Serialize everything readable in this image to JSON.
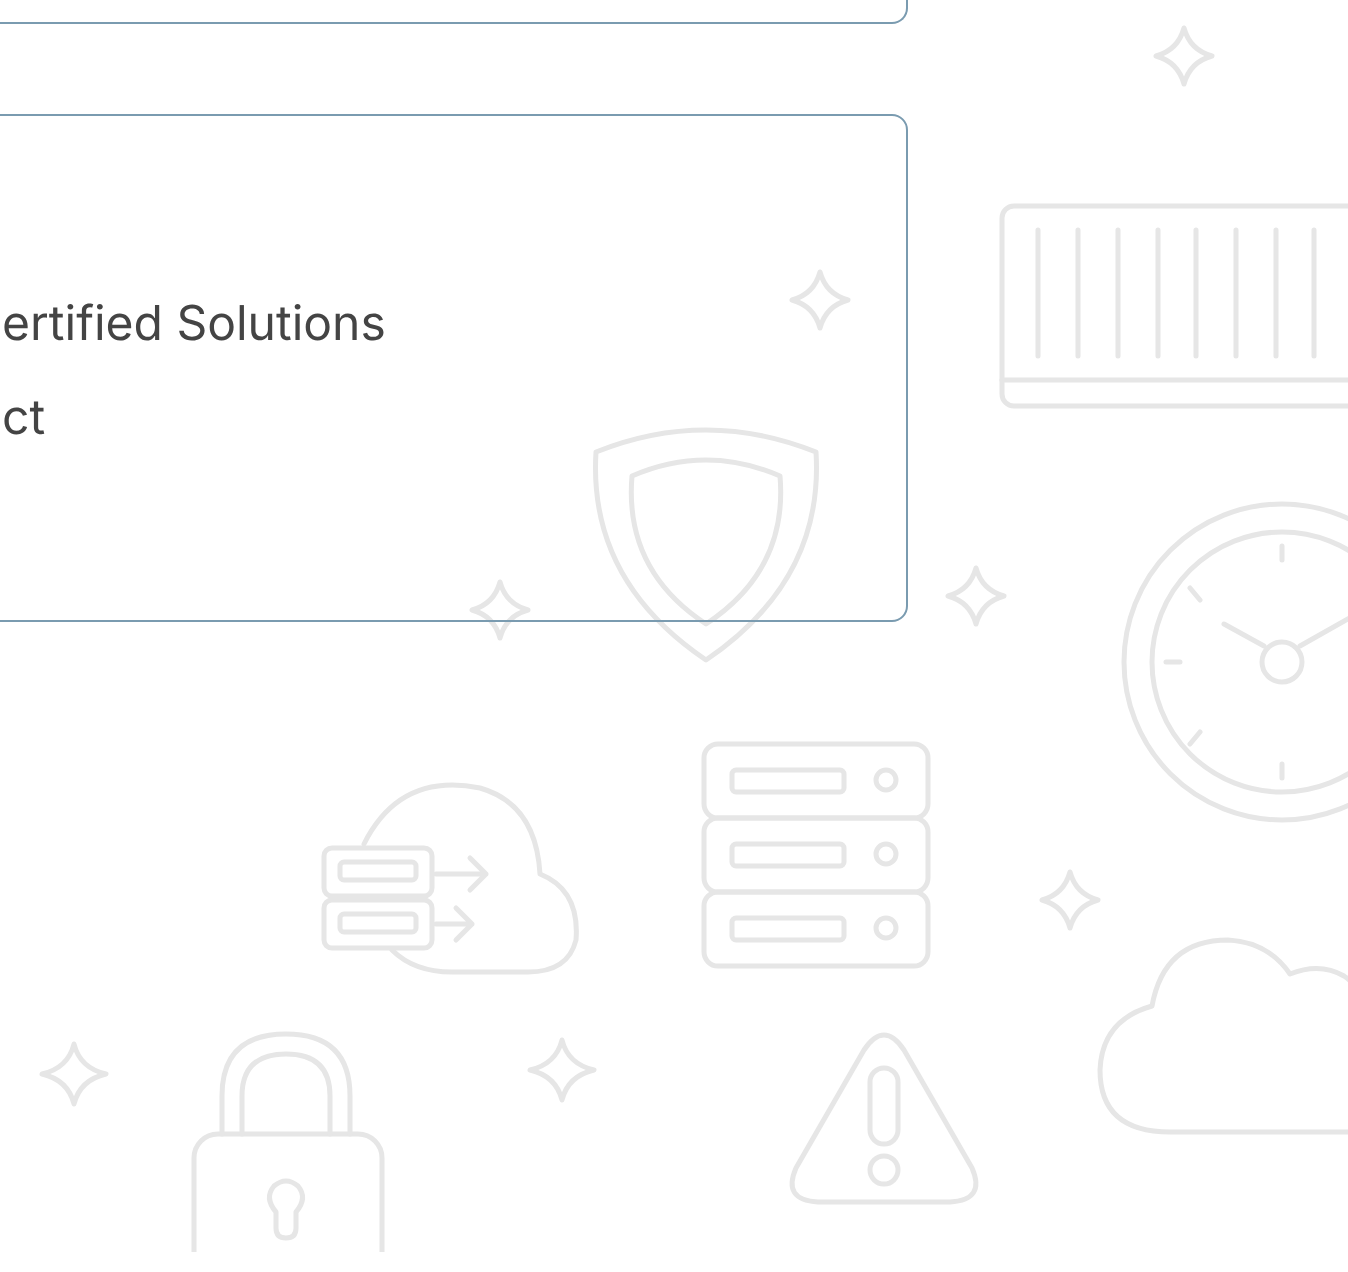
{
  "card": {
    "lines": [
      "ertified Solutions",
      "ct"
    ]
  }
}
